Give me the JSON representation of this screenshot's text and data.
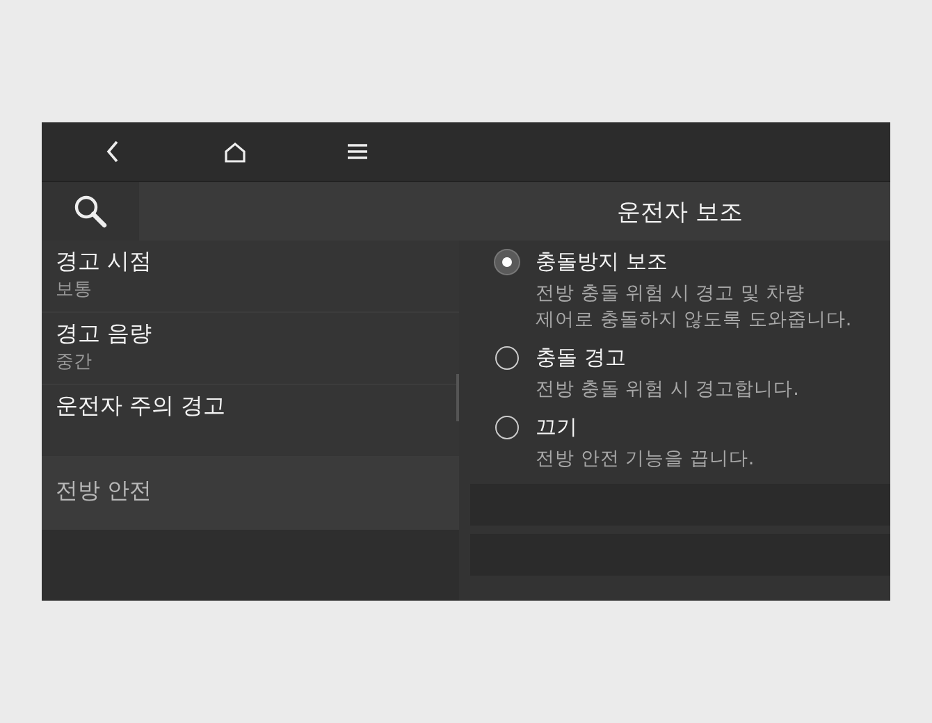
{
  "nav_bar": {
    "buttons": [
      {
        "kind": "back"
      },
      {
        "kind": "home"
      },
      {
        "kind": "menu"
      }
    ]
  },
  "header": {
    "title": "운전자 보조"
  },
  "settings_list": [
    {
      "kind": "setting",
      "title": "경고 시점",
      "value": "보통"
    },
    {
      "kind": "setting",
      "title": "경고 음량",
      "value": "중간"
    },
    {
      "kind": "setting",
      "title": "운전자 주의 경고"
    },
    {
      "kind": "section",
      "title": "전방 안전"
    }
  ],
  "options": [
    {
      "label": "충돌방지 보조",
      "description": "전방 충돌 위험 시 경고 및 차량\n제어로 충돌하지 않도록 도와줍니다.",
      "selected": true
    },
    {
      "label": "충돌 경고",
      "description": "전방 충돌 위험 시 경고합니다.",
      "selected": false
    },
    {
      "label": "끄기",
      "description": "전방 안전 기능을 끕니다.",
      "selected": false
    }
  ]
}
